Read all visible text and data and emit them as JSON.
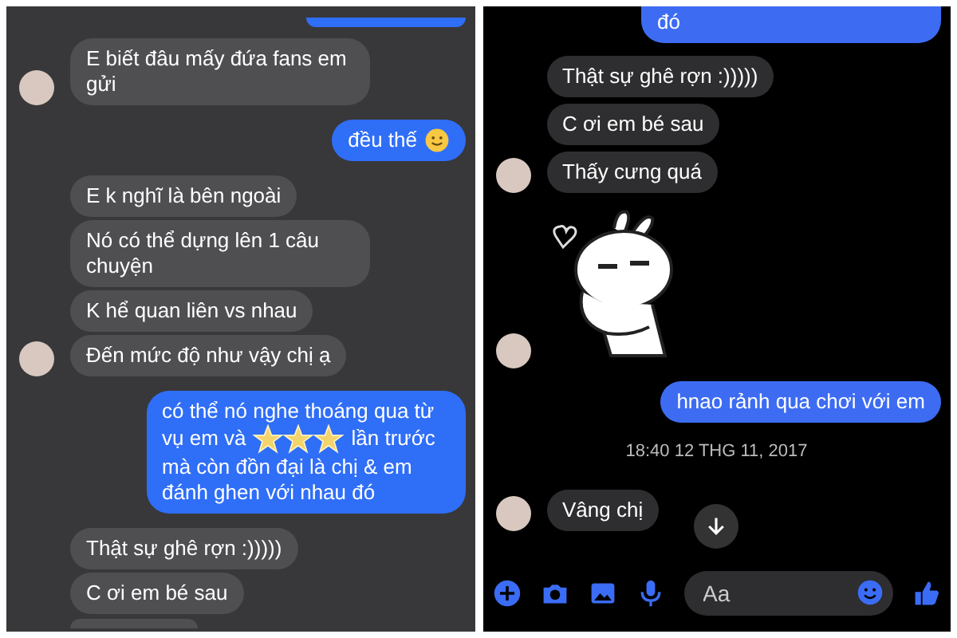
{
  "panels": [
    {
      "kind": "gray",
      "messages": [
        {
          "kind": "incoming",
          "avatar": true,
          "text": "E biết đâu mấy đứa fans em gửi"
        },
        {
          "kind": "outgoing",
          "text": "đều thế",
          "emoji": true
        },
        {
          "kind": "incoming",
          "avatar": false,
          "text": "E k nghĩ là bên ngoài"
        },
        {
          "kind": "incoming",
          "avatar": false,
          "text": "Nó có thể dựng lên 1 câu chuyện"
        },
        {
          "kind": "incoming",
          "avatar": false,
          "text": "K hể quan liên vs nhau"
        },
        {
          "kind": "incoming",
          "avatar": true,
          "text": "Đến mức độ như vậy chị ạ"
        },
        {
          "kind": "outgoing",
          "text": "có thể nó nghe thoáng qua từ vụ em và",
          "stars": true,
          "text_after": "lần trước mà còn đồn đại là chị & em đánh ghen với nhau đó"
        },
        {
          "kind": "incoming",
          "avatar": false,
          "text": "Thật sự ghê rợn :)))))"
        },
        {
          "kind": "incoming",
          "avatar": false,
          "text": "C ơi em bé sau"
        }
      ]
    },
    {
      "kind": "dark",
      "messages": [
        {
          "kind": "outgoing",
          "text": "đó",
          "cut": true
        },
        {
          "kind": "incoming",
          "avatar": false,
          "text": "Thật sự ghê rợn :)))))"
        },
        {
          "kind": "incoming",
          "avatar": false,
          "text": "C ơi em bé sau"
        },
        {
          "kind": "incoming",
          "avatar": true,
          "text": "Thấy cưng quá"
        },
        {
          "kind": "sticker",
          "avatar": true
        },
        {
          "kind": "outgoing",
          "text": "hnao rảnh qua chơi với em"
        },
        {
          "kind": "timestamp",
          "text": "18:40 12 THG 11, 2017"
        },
        {
          "kind": "incoming",
          "avatar": true,
          "text": "Vâng chị"
        }
      ],
      "scroll_down": true,
      "composer": {
        "placeholder": "Aa"
      }
    }
  ]
}
